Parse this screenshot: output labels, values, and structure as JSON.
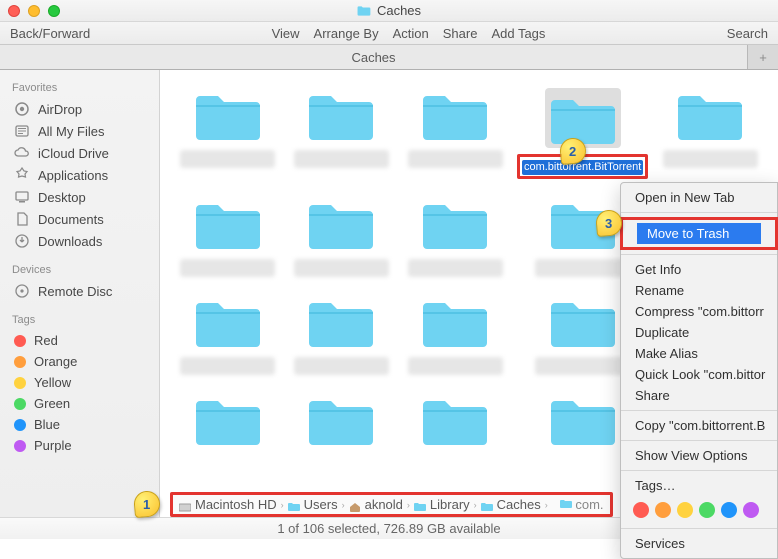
{
  "window": {
    "title": "Caches"
  },
  "toolbar": {
    "back_forward": "Back/Forward",
    "view": "View",
    "arrange": "Arrange By",
    "action": "Action",
    "share": "Share",
    "add_tags": "Add Tags",
    "search": "Search"
  },
  "tabs": {
    "active": "Caches",
    "new_tab_glyph": "+"
  },
  "sidebar": {
    "favorites_hdr": "Favorites",
    "favorites": [
      {
        "label": "AirDrop"
      },
      {
        "label": "All My Files"
      },
      {
        "label": "iCloud Drive"
      },
      {
        "label": "Applications"
      },
      {
        "label": "Desktop"
      },
      {
        "label": "Documents"
      },
      {
        "label": "Downloads"
      }
    ],
    "devices_hdr": "Devices",
    "devices": [
      {
        "label": "Remote Disc"
      }
    ],
    "tags_hdr": "Tags",
    "tags": [
      {
        "label": "Red",
        "color": "#ff5b52"
      },
      {
        "label": "Orange",
        "color": "#ff9e3d"
      },
      {
        "label": "Yellow",
        "color": "#ffd23f"
      },
      {
        "label": "Green",
        "color": "#4cd964"
      },
      {
        "label": "Blue",
        "color": "#2094fa"
      },
      {
        "label": "Purple",
        "color": "#bf5af2"
      }
    ]
  },
  "selected_folder": "com.bittorrent.BitTorrent",
  "path": {
    "segments": [
      "Macintosh HD",
      "Users",
      "aknold",
      "Library",
      "Caches"
    ],
    "trailing": "com."
  },
  "status": "1 of 106 selected, 726.89 GB available",
  "context_menu": {
    "open_new_tab": "Open in New Tab",
    "move_to_trash": "Move to Trash",
    "get_info": "Get Info",
    "rename": "Rename",
    "compress": "Compress \"com.bittorr",
    "duplicate": "Duplicate",
    "make_alias": "Make Alias",
    "quick_look": "Quick Look \"com.bittor",
    "share": "Share",
    "copy": "Copy \"com.bittorrent.B",
    "show_view_options": "Show View Options",
    "tags_label": "Tags…",
    "tag_colors": [
      "#ff5b52",
      "#ff9e3d",
      "#ffd23f",
      "#4cd964",
      "#2094fa",
      "#bf5af2",
      "#9e9e9e"
    ],
    "services": "Services"
  },
  "callouts": {
    "one": "1",
    "two": "2",
    "three": "3"
  }
}
